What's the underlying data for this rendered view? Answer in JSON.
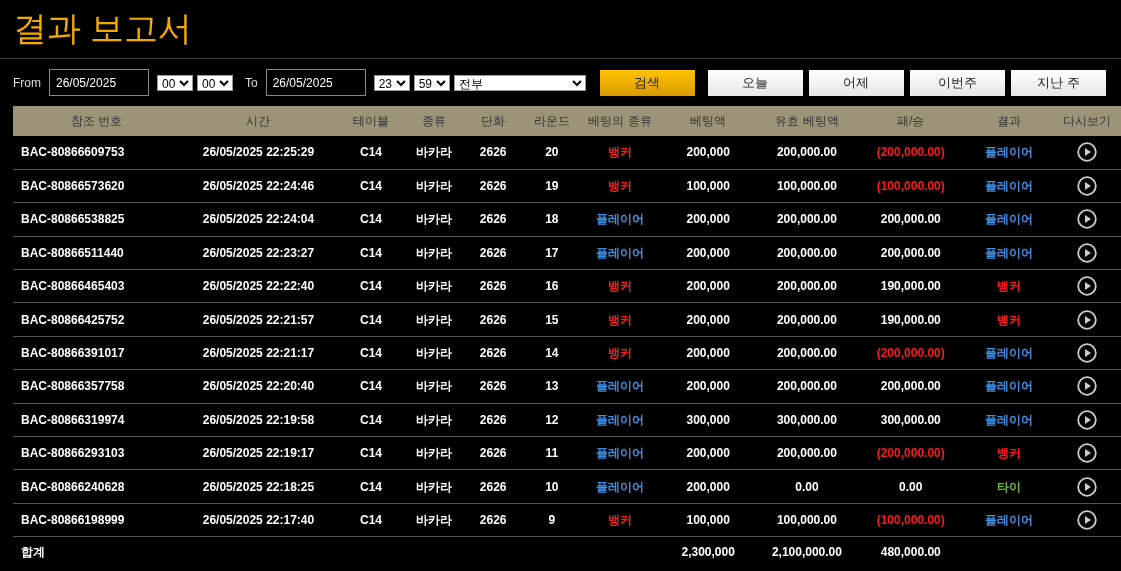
{
  "title": "결과 보고서",
  "filter": {
    "from_label": "From",
    "from_date": "26/05/2025",
    "from_hour": "00",
    "from_minute": "00",
    "to_label": "To",
    "to_date": "26/05/2025",
    "to_hour": "23",
    "to_minute": "59",
    "bet_filter": "전부"
  },
  "buttons": [
    {
      "label": "검색",
      "kind": "primary"
    },
    {
      "label": "오늘",
      "kind": "preset"
    },
    {
      "label": "어제",
      "kind": "preset"
    },
    {
      "label": "이번주",
      "kind": "preset"
    },
    {
      "label": "지난 주",
      "kind": "preset"
    }
  ],
  "table": {
    "columns": [
      "참조 번호",
      "시간",
      "테이블",
      "종류",
      "단화",
      "라운드",
      "베팅의 종류",
      "베팅액",
      "유효 베팅액",
      "패/승",
      "결과",
      "다시보기"
    ],
    "rows": [
      {
        "ref": "BAC-80866609753",
        "time": "26/05/2025 22:25:29",
        "table": "C14",
        "game": "바카라",
        "dealer": "2626",
        "round": "20",
        "bet_type": {
          "text": "뱅커",
          "color": "#ff1a1a"
        },
        "bet": "200,000",
        "valid_bet": "200,000.00",
        "win_loss": {
          "text": "(200,000.00)",
          "color": "#ff1a1a"
        },
        "result": {
          "text": "플레이어",
          "color": "#3d8fe6"
        }
      },
      {
        "ref": "BAC-80866573620",
        "time": "26/05/2025 22:24:46",
        "table": "C14",
        "game": "바카라",
        "dealer": "2626",
        "round": "19",
        "bet_type": {
          "text": "뱅커",
          "color": "#ff1a1a"
        },
        "bet": "100,000",
        "valid_bet": "100,000.00",
        "win_loss": {
          "text": "(100,000.00)",
          "color": "#ff1a1a"
        },
        "result": {
          "text": "플레이어",
          "color": "#3d8fe6"
        }
      },
      {
        "ref": "BAC-80866538825",
        "time": "26/05/2025 22:24:04",
        "table": "C14",
        "game": "바카라",
        "dealer": "2626",
        "round": "18",
        "bet_type": {
          "text": "플레이어",
          "color": "#3d8fe6"
        },
        "bet": "200,000",
        "valid_bet": "200,000.00",
        "win_loss": {
          "text": "200,000.00",
          "color": "#ffffff"
        },
        "result": {
          "text": "플레이어",
          "color": "#3d8fe6"
        }
      },
      {
        "ref": "BAC-80866511440",
        "time": "26/05/2025 22:23:27",
        "table": "C14",
        "game": "바카라",
        "dealer": "2626",
        "round": "17",
        "bet_type": {
          "text": "플레이어",
          "color": "#3d8fe6"
        },
        "bet": "200,000",
        "valid_bet": "200,000.00",
        "win_loss": {
          "text": "200,000.00",
          "color": "#ffffff"
        },
        "result": {
          "text": "플레이어",
          "color": "#3d8fe6"
        }
      },
      {
        "ref": "BAC-80866465403",
        "time": "26/05/2025 22:22:40",
        "table": "C14",
        "game": "바카라",
        "dealer": "2626",
        "round": "16",
        "bet_type": {
          "text": "뱅커",
          "color": "#ff1a1a"
        },
        "bet": "200,000",
        "valid_bet": "200,000.00",
        "win_loss": {
          "text": "190,000.00",
          "color": "#ffffff"
        },
        "result": {
          "text": "뱅커",
          "color": "#ff1a1a"
        }
      },
      {
        "ref": "BAC-80866425752",
        "time": "26/05/2025 22:21:57",
        "table": "C14",
        "game": "바카라",
        "dealer": "2626",
        "round": "15",
        "bet_type": {
          "text": "뱅커",
          "color": "#ff1a1a"
        },
        "bet": "200,000",
        "valid_bet": "200,000.00",
        "win_loss": {
          "text": "190,000.00",
          "color": "#ffffff"
        },
        "result": {
          "text": "뱅커",
          "color": "#ff1a1a"
        }
      },
      {
        "ref": "BAC-80866391017",
        "time": "26/05/2025 22:21:17",
        "table": "C14",
        "game": "바카라",
        "dealer": "2626",
        "round": "14",
        "bet_type": {
          "text": "뱅커",
          "color": "#ff1a1a"
        },
        "bet": "200,000",
        "valid_bet": "200,000.00",
        "win_loss": {
          "text": "(200,000.00)",
          "color": "#ff1a1a"
        },
        "result": {
          "text": "플레이어",
          "color": "#3d8fe6"
        }
      },
      {
        "ref": "BAC-80866357758",
        "time": "26/05/2025 22:20:40",
        "table": "C14",
        "game": "바카라",
        "dealer": "2626",
        "round": "13",
        "bet_type": {
          "text": "플레이어",
          "color": "#3d8fe6"
        },
        "bet": "200,000",
        "valid_bet": "200,000.00",
        "win_loss": {
          "text": "200,000.00",
          "color": "#ffffff"
        },
        "result": {
          "text": "플레이어",
          "color": "#3d8fe6"
        }
      },
      {
        "ref": "BAC-80866319974",
        "time": "26/05/2025 22:19:58",
        "table": "C14",
        "game": "바카라",
        "dealer": "2626",
        "round": "12",
        "bet_type": {
          "text": "플레이어",
          "color": "#3d8fe6"
        },
        "bet": "300,000",
        "valid_bet": "300,000.00",
        "win_loss": {
          "text": "300,000.00",
          "color": "#ffffff"
        },
        "result": {
          "text": "플레이어",
          "color": "#3d8fe6"
        }
      },
      {
        "ref": "BAC-80866293103",
        "time": "26/05/2025 22:19:17",
        "table": "C14",
        "game": "바카라",
        "dealer": "2626",
        "round": "11",
        "bet_type": {
          "text": "플레이어",
          "color": "#3d8fe6"
        },
        "bet": "200,000",
        "valid_bet": "200,000.00",
        "win_loss": {
          "text": "(200,000.00)",
          "color": "#ff1a1a"
        },
        "result": {
          "text": "뱅커",
          "color": "#ff1a1a"
        }
      },
      {
        "ref": "BAC-80866240628",
        "time": "26/05/2025 22:18:25",
        "table": "C14",
        "game": "바카라",
        "dealer": "2626",
        "round": "10",
        "bet_type": {
          "text": "플레이어",
          "color": "#3d8fe6"
        },
        "bet": "200,000",
        "valid_bet": "0.00",
        "win_loss": {
          "text": "0.00",
          "color": "#ffffff"
        },
        "result": {
          "text": "타이",
          "color": "#6cbf2a"
        }
      },
      {
        "ref": "BAC-80866198999",
        "time": "26/05/2025 22:17:40",
        "table": "C14",
        "game": "바카라",
        "dealer": "2626",
        "round": "9",
        "bet_type": {
          "text": "뱅커",
          "color": "#ff1a1a"
        },
        "bet": "100,000",
        "valid_bet": "100,000.00",
        "win_loss": {
          "text": "(100,000.00)",
          "color": "#ff1a1a"
        },
        "result": {
          "text": "플레이어",
          "color": "#3d8fe6"
        }
      }
    ],
    "totals": {
      "label": "합계",
      "bet": "2,300,000",
      "valid_bet": "2,100,000.00",
      "win_loss": "480,000.00"
    }
  }
}
